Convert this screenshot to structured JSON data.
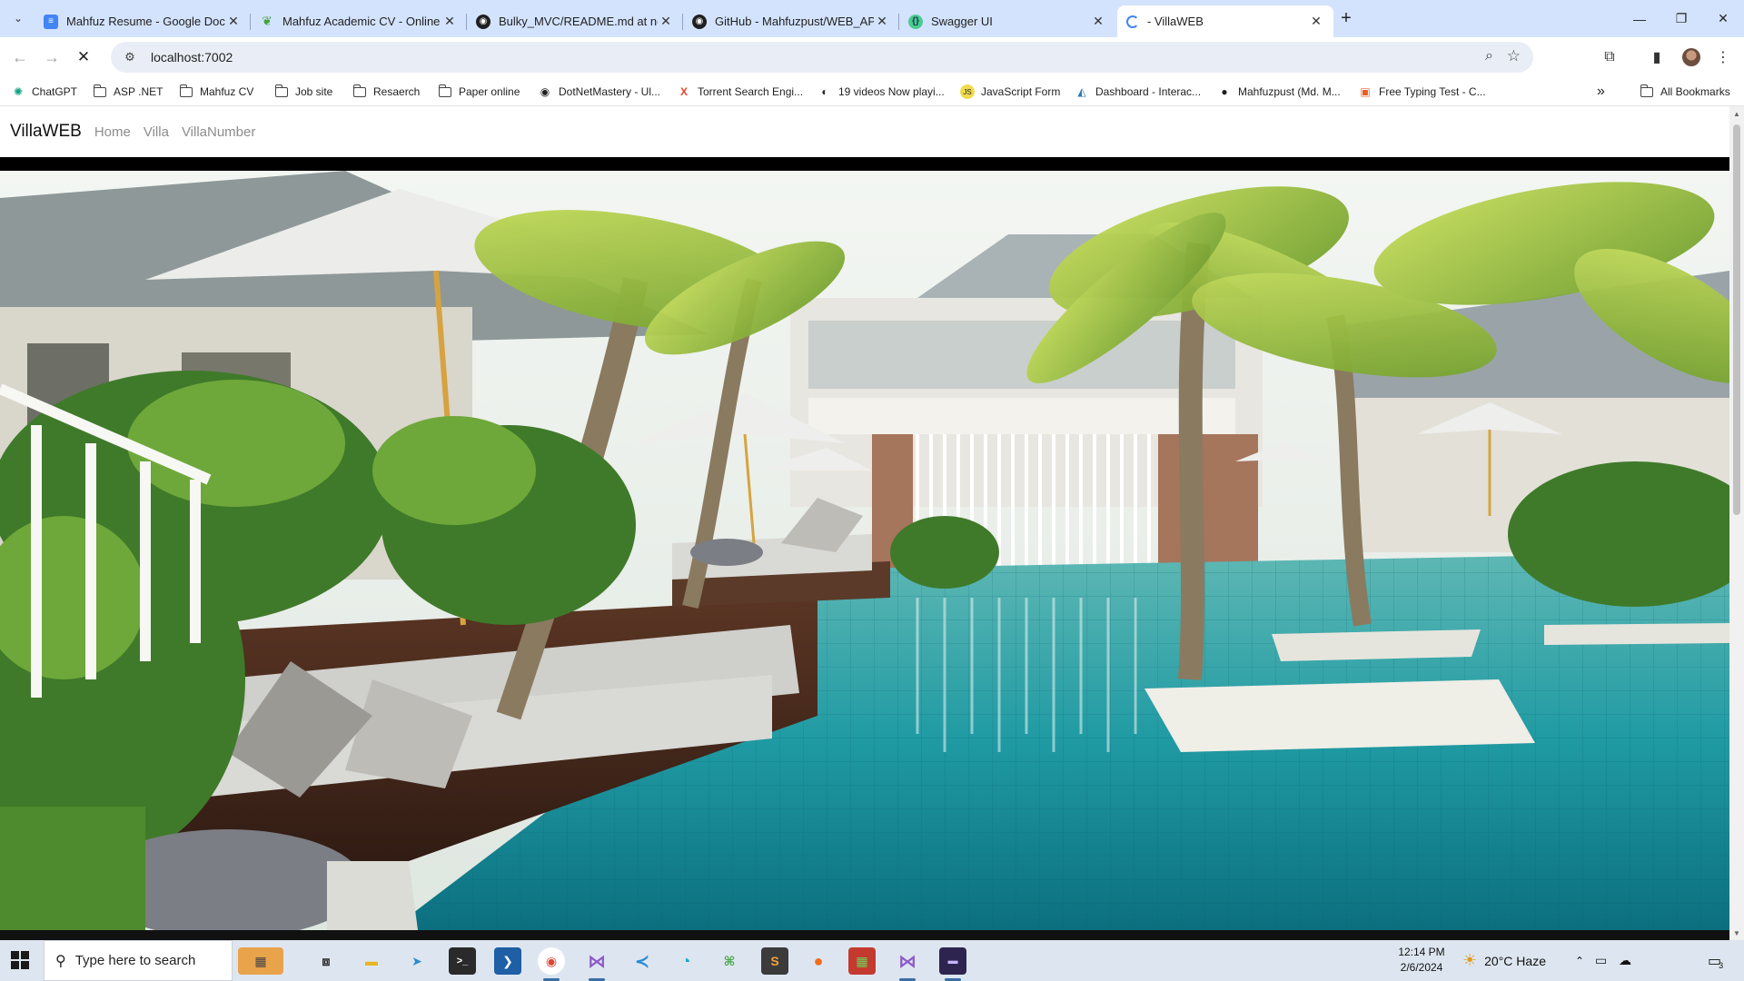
{
  "browser": {
    "tabs": [
      {
        "title": "Mahfuz Resume - Google Docs",
        "icon": "google-docs-icon",
        "color": "#4285f4"
      },
      {
        "title": "Mahfuz Academic CV - Online L",
        "icon": "overleaf-icon",
        "color": "#47a141"
      },
      {
        "title": "Bulky_MVC/README.md at new",
        "icon": "github-icon",
        "color": "#1f1f1f"
      },
      {
        "title": "GitHub - Mahfuzpust/WEB_API",
        "icon": "github-icon",
        "color": "#1f1f1f"
      },
      {
        "title": "Swagger UI",
        "icon": "swagger-icon",
        "color": "#49cc90"
      },
      {
        "title": " - VillaWEB",
        "icon": "loading-spinner-icon",
        "color": "#4285f4",
        "active": true
      }
    ],
    "new_tab_label": "+",
    "url": "localhost:7002",
    "bookmarks": [
      {
        "label": "ChatGPT",
        "icon": "chatgpt-icon"
      },
      {
        "label": "ASP .NET",
        "icon": "folder-icon"
      },
      {
        "label": "Mahfuz CV",
        "icon": "folder-icon"
      },
      {
        "label": "Job site",
        "icon": "folder-icon"
      },
      {
        "label": "Resaerch",
        "icon": "folder-icon"
      },
      {
        "label": "Paper online",
        "icon": "folder-icon"
      },
      {
        "label": "DotNetMastery - Ul...",
        "icon": "dotnetmastery-icon"
      },
      {
        "label": "Torrent Search Engi...",
        "icon": "torrent-x-icon"
      },
      {
        "label": "19 videos Now playi...",
        "icon": "video-icon"
      },
      {
        "label": "JavaScript Form",
        "icon": "javascript-icon"
      },
      {
        "label": "Dashboard - Interac...",
        "icon": "dashboard-icon"
      },
      {
        "label": "Mahfuzpust (Md. M...",
        "icon": "github-icon"
      },
      {
        "label": "Free Typing Test - C...",
        "icon": "typing-test-icon"
      }
    ],
    "bookmarks_overflow": "»",
    "all_bookmarks": "All Bookmarks"
  },
  "site": {
    "brand": "VillaWEB",
    "nav": [
      "Home",
      "Villa",
      "VillaNumber"
    ]
  },
  "taskbar": {
    "search_placeholder": "Type here to search",
    "weather": "20°C  Haze",
    "time": "12:14 PM",
    "date": "2/6/2024",
    "notification_count": "3"
  }
}
